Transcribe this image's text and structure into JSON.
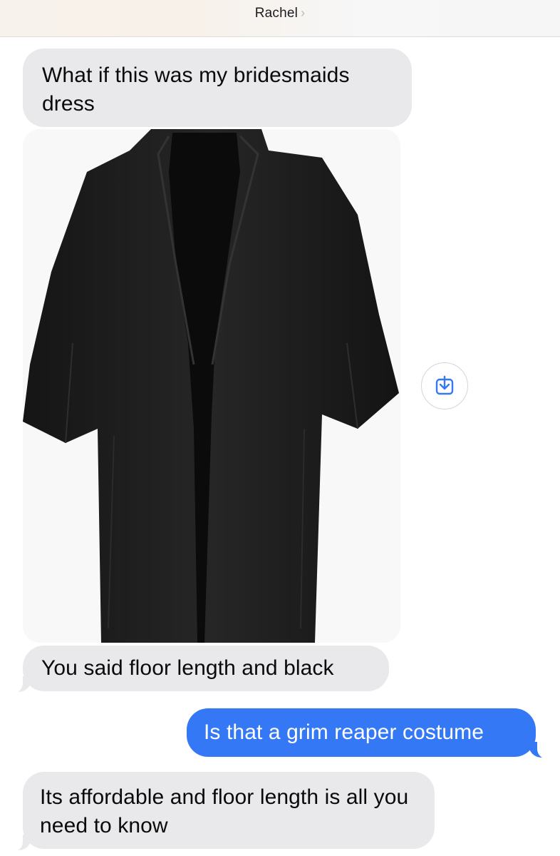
{
  "header": {
    "contact_name": "Rachel",
    "chevron": "›"
  },
  "messages": [
    {
      "direction": "incoming",
      "text": "What if this was my bridesmaids dress"
    },
    {
      "direction": "incoming",
      "type": "image",
      "image_description": "black hooded robe"
    },
    {
      "direction": "incoming",
      "text": "You said floor length and black"
    },
    {
      "direction": "outgoing",
      "text": "Is that a grim reaper costume"
    },
    {
      "direction": "incoming",
      "text": "Its affordable and floor length is all you need to know"
    }
  ],
  "colors": {
    "incoming_bubble": "#e9e9eb",
    "outgoing_bubble": "#3478f6",
    "robe": "#1d1d1d",
    "accent": "#3478f6"
  },
  "icons": {
    "save": "save-to-device-icon"
  }
}
